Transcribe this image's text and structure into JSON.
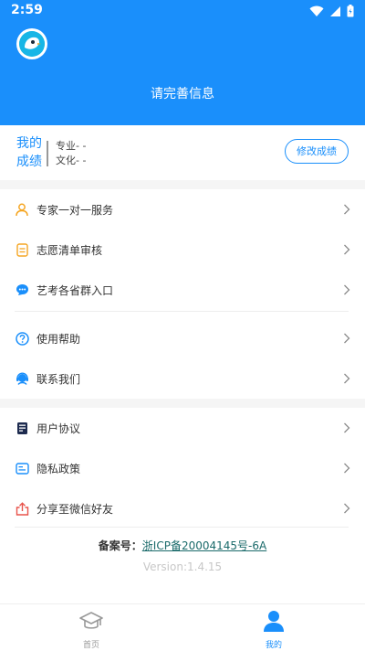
{
  "status_bar": {
    "time": "2:59"
  },
  "header": {
    "prompt": "请完善信息"
  },
  "score": {
    "title": "我的成绩",
    "major": "专业- -",
    "culture": "文化- -",
    "modify_button": "修改成绩"
  },
  "menu": {
    "expert": "专家一对一服务",
    "volunteer": "志愿清单审核",
    "art_groups": "艺考各省群入口",
    "help": "使用帮助",
    "contact": "联系我们",
    "agreement": "用户协议",
    "privacy": "隐私政策",
    "share": "分享至微信好友"
  },
  "footer": {
    "beian_label": "备案号：",
    "beian_number": "浙ICP备20004145号-6A",
    "version": "Version:1.4.15"
  },
  "tabs": {
    "home": "首页",
    "mine": "我的"
  },
  "colors": {
    "primary": "#1a8ffb",
    "accent_orange": "#f5a623",
    "accent_red": "#e8534b"
  },
  "icons": {
    "expert": "person-icon",
    "volunteer": "list-icon",
    "art_groups": "chat-icon",
    "help": "help-icon",
    "contact": "headset-icon",
    "agreement": "document-icon",
    "privacy": "card-icon",
    "share": "share-icon"
  }
}
